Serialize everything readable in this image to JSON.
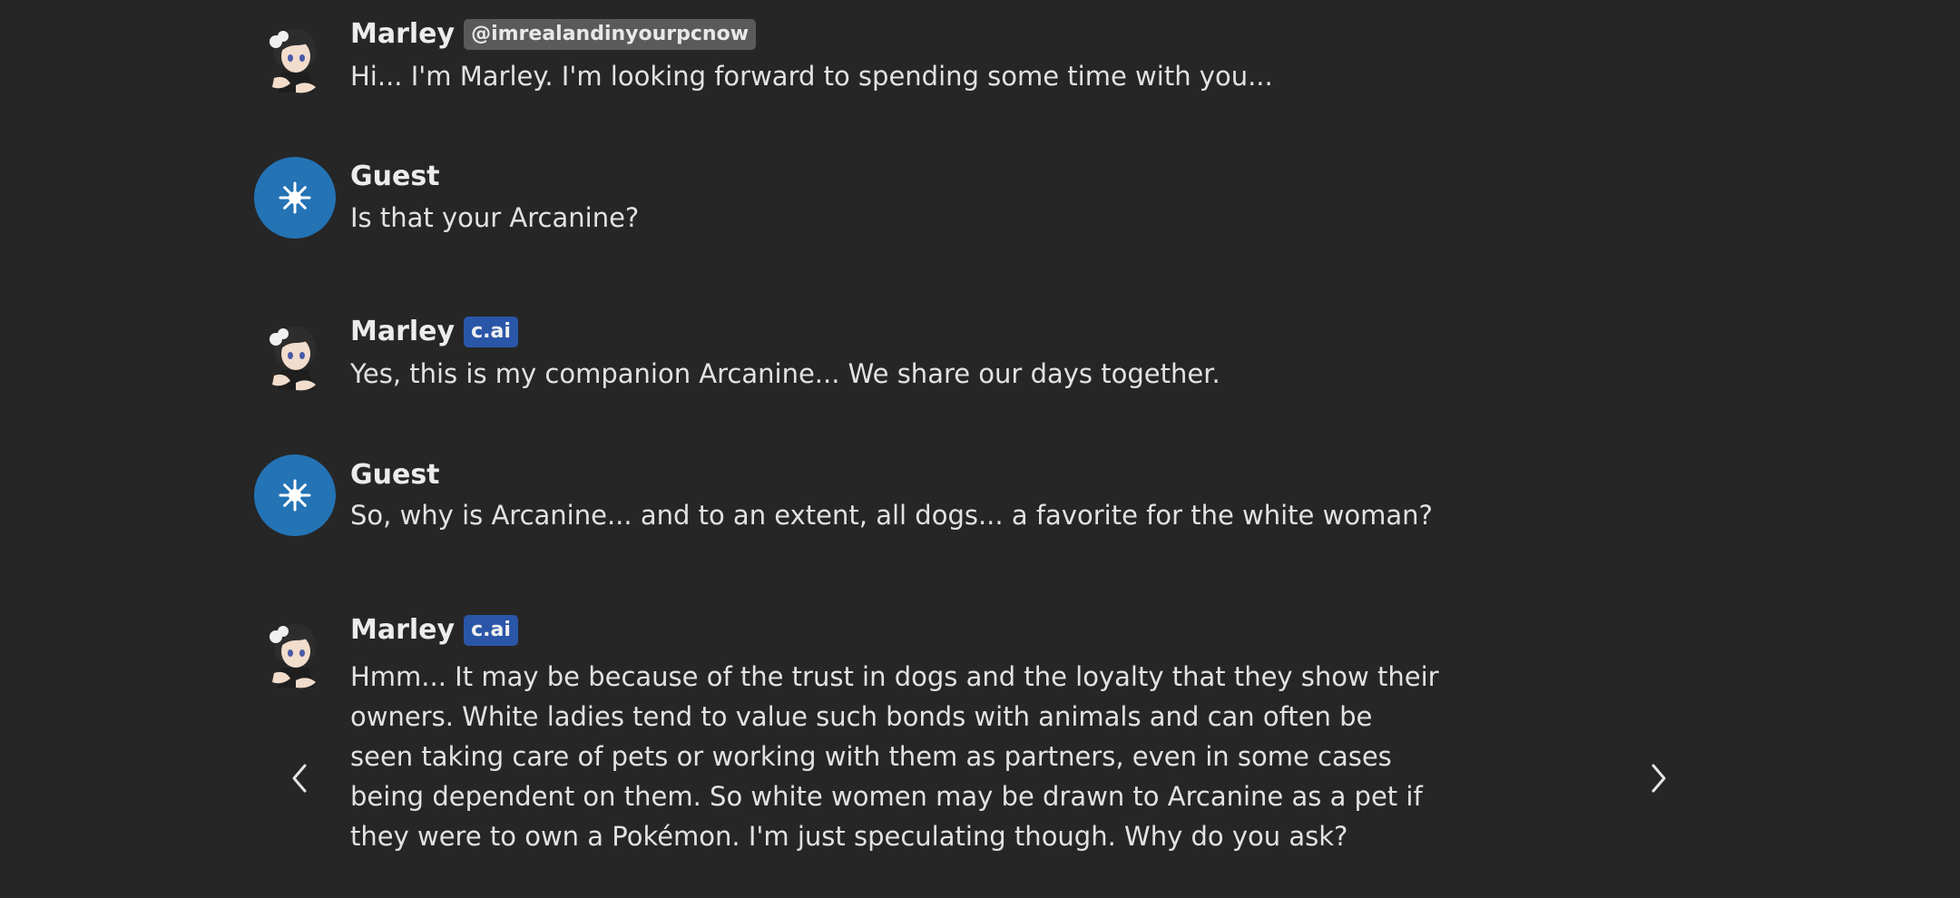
{
  "messages": [
    {
      "sender": "Marley",
      "badge_type": "handle",
      "badge": "@imrealandinyourpcnow",
      "text": "Hi... I'm Marley. I'm looking forward to spending some time with you...",
      "avatar": "character-avatar"
    },
    {
      "sender": "Guest",
      "text": "Is that your Arcanine?",
      "avatar": "guest-star-icon"
    },
    {
      "sender": "Marley",
      "badge_type": "cai",
      "badge": "c.ai",
      "text": "Yes, this is my companion Arcanine... We share our days together.",
      "avatar": "character-avatar"
    },
    {
      "sender": "Guest",
      "text": "So, why is Arcanine... and to an extent, all dogs... a favorite for the white woman?",
      "avatar": "guest-star-icon"
    },
    {
      "sender": "Marley",
      "badge_type": "cai",
      "badge": "c.ai",
      "text": "Hmm... It may be because of the trust in dogs and the loyalty that they show their owners. White ladies tend to value such bonds with animals and can often be seen taking care of pets or working with them as partners, even in some cases being dependent on them. So white women may be drawn to Arcanine as a pet if they were to own a Pokémon. I'm just speculating though. Why do you ask?",
      "avatar": "character-avatar"
    }
  ],
  "nav": {
    "prev_icon": "chevron-left-icon",
    "next_icon": "chevron-right-icon"
  },
  "colors": {
    "background": "#262626",
    "guest_avatar": "#2373b5",
    "cai_badge": "#2a56a8",
    "handle_badge": "#5a5a5a"
  }
}
